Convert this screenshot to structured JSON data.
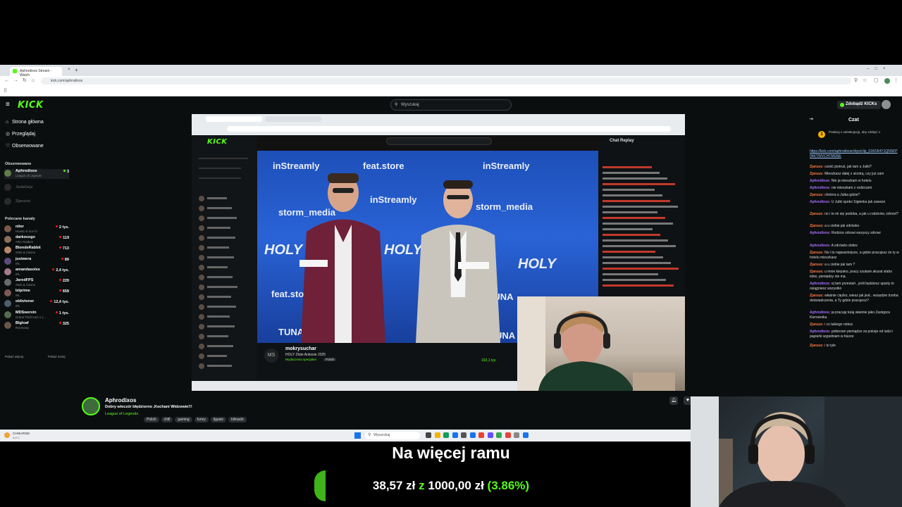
{
  "browser": {
    "tabs": [
      {
        "title": "Aphrodixos Stream - Watch"
      },
      {
        "title": ""
      }
    ],
    "url": "kick.com/aphrodixos"
  },
  "topnav": {
    "logo": "KICK",
    "search_placeholder": "Wyszukaj",
    "kicks_button": "Zdobądź KICKs"
  },
  "sidebar": {
    "nav": [
      {
        "label": "Strona główna",
        "icon": "home-icon"
      },
      {
        "label": "Przeglądaj",
        "icon": "compass-icon"
      },
      {
        "label": "Obserwowane",
        "icon": "heart-icon"
      }
    ],
    "followed_title": "Obserwowane",
    "followed": [
      {
        "name": "Aphrodixos",
        "category": "League of Legends",
        "viewers": "3",
        "live": true
      },
      {
        "name": "JodaGejz",
        "category": "",
        "viewers": "",
        "live": false
      },
      {
        "name": "Zjaruusi",
        "category": "",
        "viewers": "",
        "live": false
      }
    ],
    "recommended_title": "Polecane kanały",
    "recommended": [
      {
        "name": "niter",
        "category": "Hearts of Iron IV",
        "viewers": "2 tys."
      },
      {
        "name": "darkocego",
        "category": "ARC Raiders",
        "viewers": "119"
      },
      {
        "name": "BlondeRabbit",
        "category": "Slots & Casino",
        "viewers": "713"
      },
      {
        "name": "justwera",
        "category": "IRL",
        "viewers": "89"
      },
      {
        "name": "amandasolss",
        "category": "IRL",
        "viewers": "2,4 tys."
      },
      {
        "name": "JaredFPS",
        "category": "Slots & Casino",
        "viewers": "229"
      },
      {
        "name": "Izlprime",
        "category": "IRL",
        "viewers": "659"
      },
      {
        "name": "oblivionsr",
        "category": "IRL",
        "viewers": "12,4 tys."
      },
      {
        "name": "MDSwervin",
        "category": "Grand Theft Auto V (...",
        "viewers": "1 tys."
      },
      {
        "name": "Bigloaf",
        "category": "Rozmowy",
        "viewers": "325"
      }
    ],
    "show_more": "Pokaż więcej",
    "show_less": "Pokaż mniej"
  },
  "video": {
    "inner_channel": "mokrysuchar",
    "inner_title": "HOLY Złote Ankosie 2025",
    "inner_category": "Wydarzenia specjalne",
    "inner_tag": "Polish",
    "inner_viewers": "163,1 tys.",
    "inner_chat_header": "Chat Replay",
    "wall_words": [
      "inStreamly",
      "feat.store",
      "storm_media",
      "HOLY",
      "FORTUNA",
      "TUNA"
    ]
  },
  "chat": {
    "header": "Czat",
    "sub_prompt": "Podaruj 1 subskrypcję, aby zdobyć 1",
    "messages": [
      {
        "user": "",
        "text": "https://kick.com/aphrodixos/clips/clip_01KFA4Y1QNSFP06KTWVCHTMENE"
      },
      {
        "user": "Zjaruus:",
        "text": "cześć piotruś, jak tam u Jutki?",
        "cls": "u3"
      },
      {
        "user": "Zjaruus:",
        "text": "Mieszkasz dalej z siostrą, czy już sam",
        "cls": "u3"
      },
      {
        "user": "Aphrodixos:",
        "text": "Nie ja mieszkam w hotelu",
        "cls": "u1"
      },
      {
        "user": "Aphrodixos:",
        "text": "nie mieszkam z rodzicami",
        "cls": "u1"
      },
      {
        "user": "Zjaruus:",
        "text": "cholera a Jutka gdzie?",
        "cls": "u3"
      },
      {
        "user": "Aphrodixos:",
        "text": "U Jutki spoko Sigienka jak zawsze",
        "cls": "u1"
      },
      {
        "user": "Zjaruus:",
        "text": "no i to mi się podoba, a jak u rodziców, zdrowi?",
        "cls": "u3"
      },
      {
        "user": "Zjaruus:",
        "text": "a u ciebie jak zdrówko",
        "cls": "u3"
      },
      {
        "user": "Aphrodixos:",
        "text": "Rodzice zdrowi wszyscy zdrowi",
        "cls": "u1"
      },
      {
        "user": "Aphrodixos:",
        "text": "A zdrówko dobre",
        "cls": "u1"
      },
      {
        "user": "Zjaruus:",
        "text": "No i to najważniejsze, a gdzie pracujesz że ty w hotelu mieszkasz",
        "cls": "u3"
      },
      {
        "user": "Zjaruus:",
        "text": "a u ciebie jak tam ?",
        "cls": "u3"
      },
      {
        "user": "Zjaruus:",
        "text": "u mnie kiepsko, pracy szukam akurat stabo idzie, pieniędzy nie ma.",
        "cls": "u3"
      },
      {
        "user": "Aphrodixos:",
        "text": "ej tam przestań , jeśli będziesz uparty to osiągniesz wszystko",
        "cls": "u1"
      },
      {
        "user": "Zjaruus:",
        "text": "właśnie ciężko, wiesz jak jest.. wszędzie trzeba doświadczenia, a Ty gdzie pracujesz?",
        "cls": "u3"
      },
      {
        "user": "Aphrodixos:",
        "text": "ja pracuję tutaj właśnie jako Zastępca Kierownika",
        "cls": "u1"
      },
      {
        "user": "Zjaruus:",
        "text": "i co takiego robisz",
        "cls": "u3"
      },
      {
        "user": "Aphrodixos:",
        "text": "pobieram pieniądze za pokoje od ludzi i papierki wypełniam w biurze",
        "cls": "u1"
      },
      {
        "user": "Zjaruus:",
        "text": "i to tyle",
        "cls": "u3"
      }
    ]
  },
  "stream": {
    "channel": "Aphrodixos",
    "title": "Dobry wieczór błędziorno ,Kochani Widzowie!!!",
    "category": "League of Legends",
    "tags": [
      "Polish",
      "chill",
      "gaming",
      "funny",
      "ligusie",
      "klimacik"
    ]
  },
  "taskbar": {
    "weather": "CHMURNIE",
    "weather_sub": "5,4°C",
    "search_placeholder": "Wyszukaj"
  },
  "goal": {
    "title": "Na więcej ramu",
    "current": "38,57 zł",
    "of": "z",
    "target": "1000,00 zł",
    "percent": "(3.86%)",
    "progress": 0.0386,
    "colors": {
      "current": "#ffffff",
      "of": "#53fc18",
      "target": "#ffffff",
      "percent": "#53fc18"
    }
  }
}
